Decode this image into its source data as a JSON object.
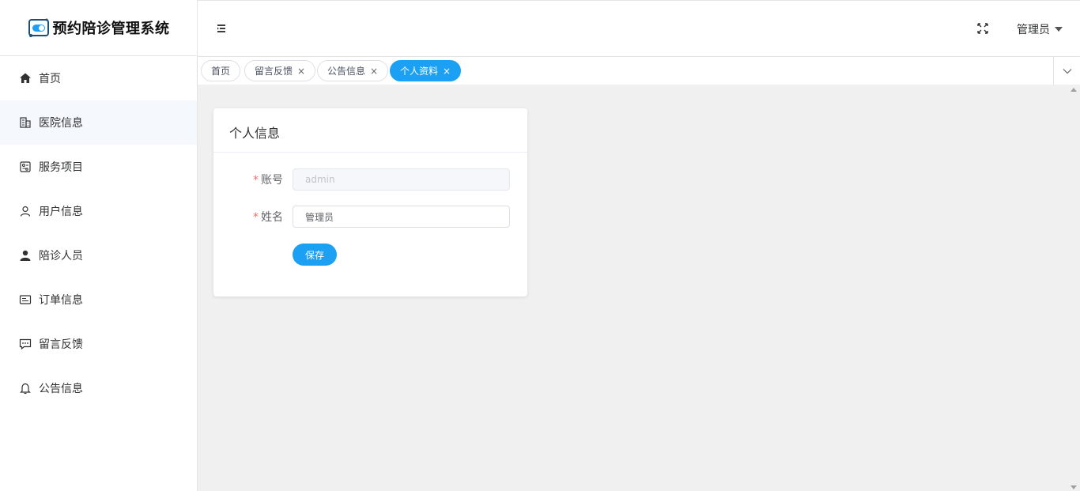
{
  "app": {
    "title": "预约陪诊管理系统",
    "accent_color": "#1ca0f4"
  },
  "sidebar": {
    "items": [
      {
        "label": "首页",
        "icon": "home-icon"
      },
      {
        "label": "医院信息",
        "icon": "building-icon"
      },
      {
        "label": "服务项目",
        "icon": "service-icon"
      },
      {
        "label": "用户信息",
        "icon": "user-icon"
      },
      {
        "label": "陪诊人员",
        "icon": "person-filled-icon"
      },
      {
        "label": "订单信息",
        "icon": "order-icon"
      },
      {
        "label": "留言反馈",
        "icon": "chat-icon"
      },
      {
        "label": "公告信息",
        "icon": "bell-icon"
      }
    ]
  },
  "header": {
    "toggle_icon": "menu-toggle-icon",
    "fullscreen_icon": "fullscreen-icon",
    "user_name": "管理员"
  },
  "tabs": [
    {
      "label": "首页",
      "closable": false
    },
    {
      "label": "留言反馈",
      "closable": true,
      "close": "×"
    },
    {
      "label": "公告信息",
      "closable": true,
      "close": "×"
    },
    {
      "label": "个人资料",
      "closable": true,
      "close": "×",
      "active": true
    }
  ],
  "profile": {
    "title": "个人信息",
    "account_label": "账号",
    "account_value": "admin",
    "name_label": "姓名",
    "name_value": "管理员",
    "required_mark": "*",
    "save_label": "保存"
  }
}
